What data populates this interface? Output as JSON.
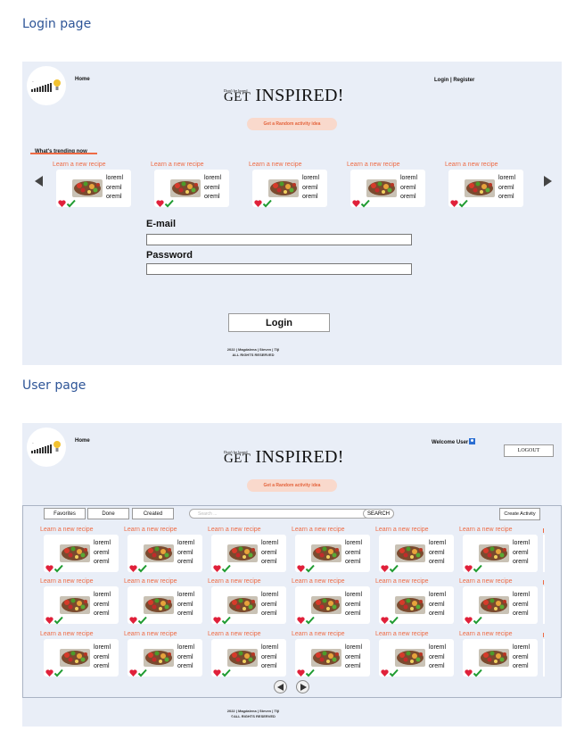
{
  "sections": {
    "login_title": "Login page",
    "user_title": "User page"
  },
  "header": {
    "home": "Home",
    "tagline": "Don't be bored",
    "brand_small": "GET",
    "brand_big": "INSPIRED!",
    "random_button": "Get a Random activity idea"
  },
  "login": {
    "auth_link": "Login | Register",
    "trending_label": "What's trending now",
    "email_label": "E-mail",
    "email_value": "",
    "password_label": "Password",
    "password_value": "",
    "login_button": "Login",
    "footer_line1": "2022 | Magdalena | Steven | TIjl",
    "footer_line2": "ALL RIGHTS RESERVED"
  },
  "card": {
    "title": "Learn a new recipe",
    "line1": "loreml",
    "line2": "oreml",
    "line3": "oreml"
  },
  "user": {
    "welcome": "Welcome User",
    "logout_button": "LOGOUT",
    "tabs": [
      "Favorites",
      "Done",
      "Created"
    ],
    "search_placeholder": "Search ...",
    "search_button": "SEARCH",
    "create_button": "Create Activity",
    "footer_line1": "2022 | Magdalena | Steven | TIjl",
    "footer_line2": "©ALL RIGHTS RESERVED"
  },
  "icons": {
    "logo": "lightbulb-bars-logo",
    "favorite": "heart-icon",
    "done": "checkmark-icon",
    "prev": "chevron-left-icon",
    "next": "chevron-right-icon",
    "user": "user-icon"
  },
  "colors": {
    "panel_bg": "#e9eef7",
    "accent": "#ee6b45",
    "random_bg": "#f9d9cc",
    "heart": "#e0203a",
    "check": "#1f9b31",
    "section_title": "#2e5597"
  }
}
